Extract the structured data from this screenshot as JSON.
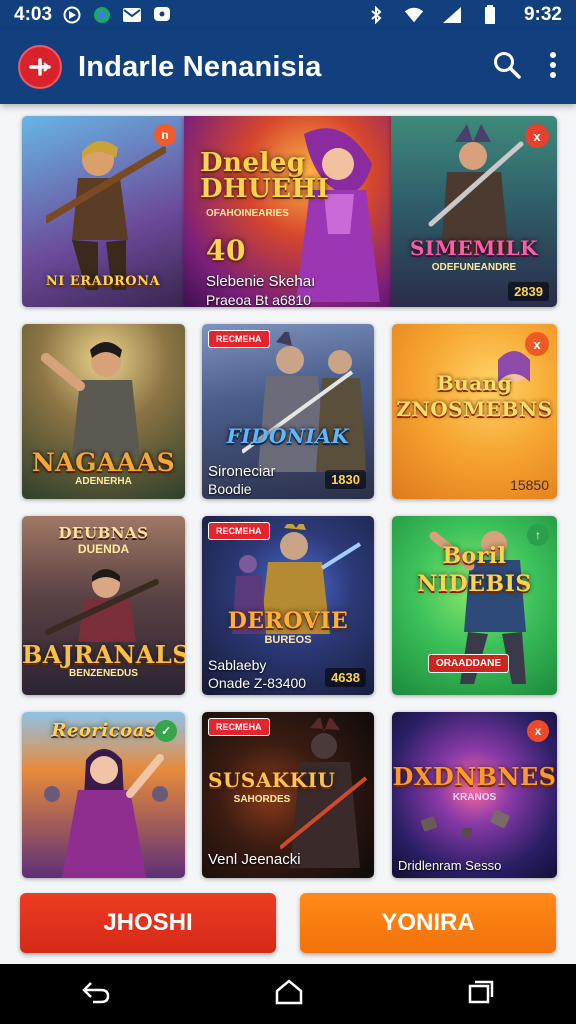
{
  "status": {
    "time": "4:03",
    "right_time": "9:32",
    "icons": [
      "media-icon",
      "whatsapp-icon",
      "mail-icon",
      "message-icon",
      "bluetooth-icon",
      "wifi-icon",
      "signal-icon",
      "battery-icon"
    ]
  },
  "app": {
    "title": "Indarle Nenanisia",
    "icons": {
      "logo": "plus-logo-icon",
      "search": "search-icon",
      "menu": "more-vert-icon"
    }
  },
  "cards": [
    {
      "title": "NI ERADRONA",
      "badge": "n",
      "colors": [
        "#5ea0d6",
        "#7b3f8f"
      ]
    },
    {
      "title": "Dneleg DHUEHI",
      "subtitle": "OFAHOINEARIES",
      "number": "40",
      "caption_line1": "Slebenie Skehaı",
      "caption_line2": "Praeoa Bt a6810",
      "colors": [
        "#8a1f8e",
        "#f06a1c"
      ]
    },
    {
      "title": "SIMEMILK",
      "subtitle": "ODEFUNEANDRE",
      "badge": "x",
      "price": "2839",
      "colors": [
        "#3a7a6b",
        "#2e4a78"
      ]
    },
    {
      "title": "NAGAAAS",
      "subtitle": "ADENERHA",
      "colors": [
        "#8b6a3a",
        "#2f3f2b"
      ]
    },
    {
      "title": "FIDONIAK",
      "tag": "RECMEHA",
      "caption_line1": "Sironeciar",
      "caption_line2": "Boodie",
      "price": "1830",
      "colors": [
        "#4a5e8c",
        "#2b2f48"
      ]
    },
    {
      "title": "Buang ZNOSMEBNS",
      "badge": "x",
      "price": "15850",
      "colors": [
        "#f6b535",
        "#e0781c"
      ]
    },
    {
      "title": "DEUBNAS",
      "subtitle": "DUENDA",
      "title2": "BAJRANALS",
      "subtitle2": "BENZENEDUS",
      "colors": [
        "#7a5c4c",
        "#2b2433"
      ]
    },
    {
      "title": "DEROVIE",
      "subtitle": "BUREOS",
      "tag": "RECMEHA",
      "caption_line1": "Sablaeby",
      "caption_line2": "Onade  Z-83400",
      "price": "4638",
      "colors": [
        "#2d3a78",
        "#161a36"
      ]
    },
    {
      "title": "Boril NIDEBIS",
      "badge": "↑",
      "banner": "ORAADDANE",
      "colors": [
        "#3cc25b",
        "#1d8a3c"
      ]
    },
    {
      "title": "Reoricoas",
      "badge": "✓",
      "colors": [
        "#e68a3b",
        "#5e2f78"
      ]
    },
    {
      "title": "SUSAKKIU",
      "tag": "RECMEHA",
      "subtitle": "SAHORDES",
      "caption_line1": "Venl Jeenacki",
      "colors": [
        "#3a1c12",
        "#0d0a0a"
      ]
    },
    {
      "title": "DXDNBNES",
      "subtitle": "KRANOS",
      "badge": "x",
      "caption_line1": "Dridlenram Sesso",
      "colors": [
        "#2a1f66",
        "#b1304f"
      ]
    }
  ],
  "buttons": {
    "left": "JHOSHI",
    "right": "YONIRA"
  },
  "nav": {
    "back": "back-icon",
    "home": "home-icon",
    "recents": "recents-icon"
  }
}
